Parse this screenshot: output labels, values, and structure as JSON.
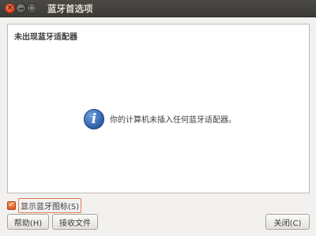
{
  "window": {
    "title": "蓝牙首选项",
    "close_glyph": "×"
  },
  "panel": {
    "heading": "未出现蓝牙适配器",
    "message": "你的计算机未插入任何蓝牙适配器。",
    "icon": "info-icon",
    "icon_glyph": "i"
  },
  "options": {
    "show_icon_label": "显示蓝牙图标(S)",
    "show_icon_checked": true,
    "check_glyph": "✓"
  },
  "buttons": {
    "help_label": "帮助(H)",
    "receive_label": "接收文件",
    "close_label": "关闭(C)"
  },
  "colors": {
    "titlebar": "#3c3b37",
    "accent": "#e0561f",
    "info_blue": "#2c5fa6"
  }
}
